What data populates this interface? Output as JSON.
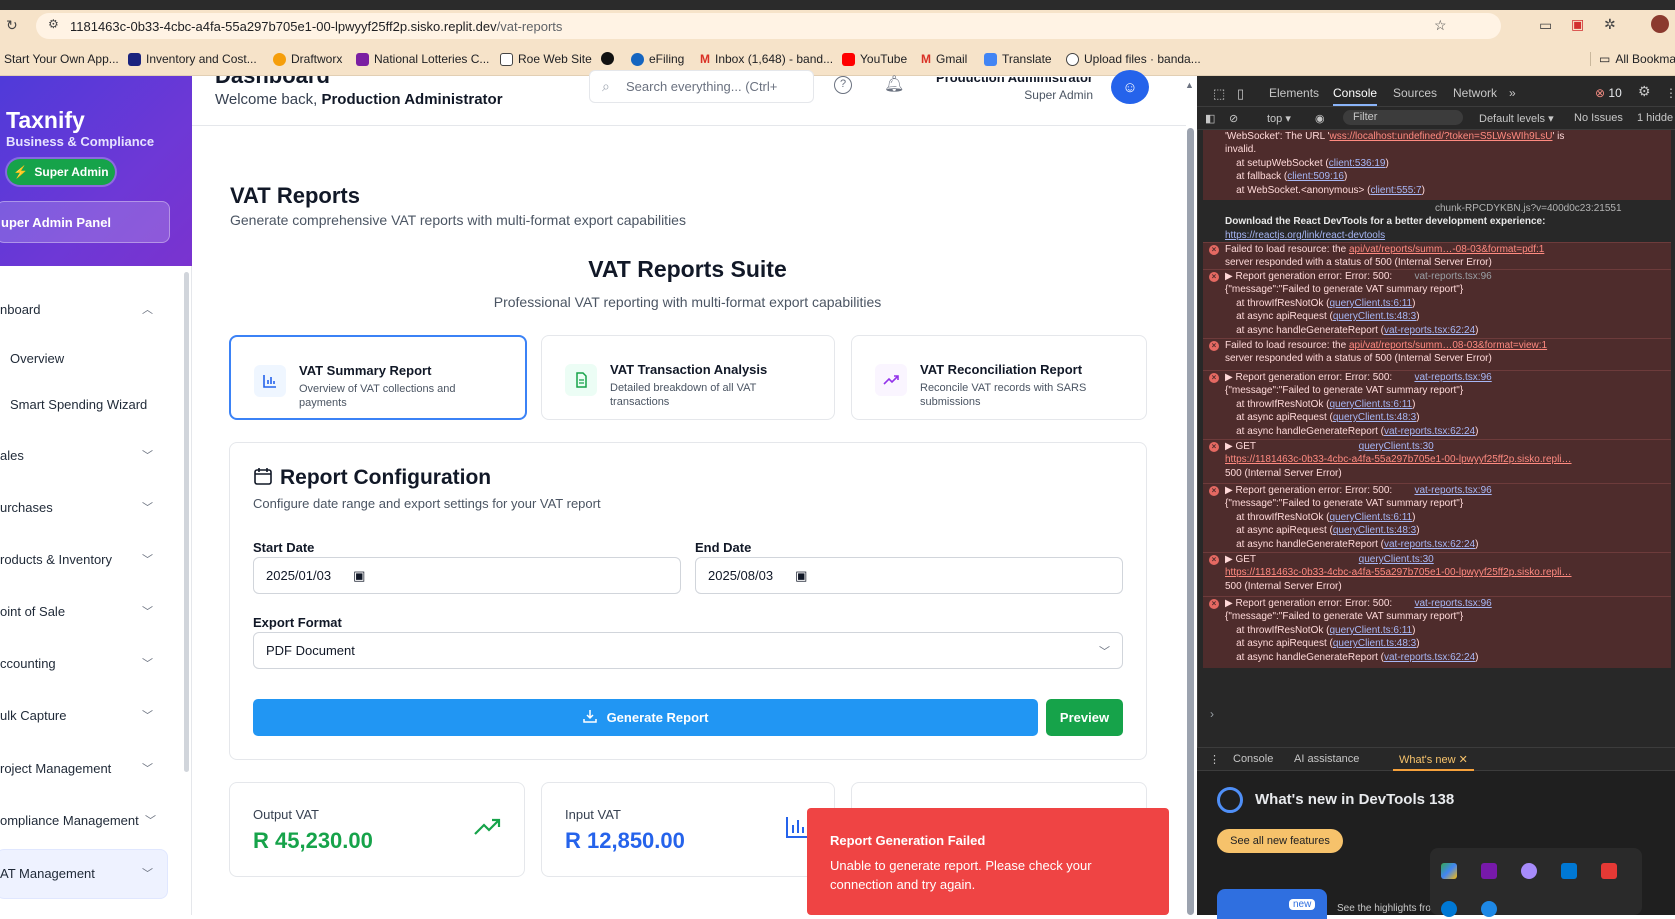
{
  "browser": {
    "url_host": "1181463c-0b33-4cbc-a4fa-55a297b705e1-00-lpwyyf25ff2p.sisko.replit.dev",
    "url_path": "/vat-reports",
    "bookmarks": [
      "Start Your Own App...",
      "Inventory and Cost...",
      "Draftworx",
      "National Lotteries C...",
      "Roe Web Site",
      "eFiling",
      "Inbox (1,648) - band...",
      "YouTube",
      "Gmail",
      "Translate",
      "Upload files · banda..."
    ],
    "all_bookmarks": "All Bookmarks"
  },
  "sidebar": {
    "brand": "Taxnify",
    "brand_sub": "Business & Compliance",
    "badge": "Super Admin",
    "panel_button": "uper Admin Panel",
    "items": [
      {
        "label": "nboard"
      },
      {
        "label": "Overview"
      },
      {
        "label": "Smart Spending Wizard"
      },
      {
        "label": "ales"
      },
      {
        "label": "urchases"
      },
      {
        "label": "roducts & Inventory"
      },
      {
        "label": "oint of Sale"
      },
      {
        "label": "ccounting"
      },
      {
        "label": "ulk Capture"
      },
      {
        "label": "roject Management"
      },
      {
        "label": "ompliance Management"
      },
      {
        "label": "AT Management"
      }
    ]
  },
  "header": {
    "title": "Dashboard",
    "welcome_prefix": "Welcome back,",
    "welcome_name": "Production Administrator",
    "search_placeholder": "Search everything... (Ctrl+",
    "user_name": "Production Administrator",
    "user_role": "Super Admin"
  },
  "main": {
    "title": "VAT Reports",
    "subtitle": "Generate comprehensive VAT reports with multi-format export capabilities",
    "suite_title": "VAT Reports Suite",
    "suite_subtitle": "Professional VAT reporting with multi-format export capabilities",
    "report_types": [
      {
        "title": "VAT Summary Report",
        "desc": "Overview of VAT collections and payments"
      },
      {
        "title": "VAT Transaction Analysis",
        "desc": "Detailed breakdown of all VAT transactions"
      },
      {
        "title": "VAT Reconciliation Report",
        "desc": "Reconcile VAT records with SARS submissions"
      }
    ],
    "config": {
      "title": "Report Configuration",
      "subtitle": "Configure date range and export settings for your VAT report",
      "start_label": "Start Date",
      "start_value": "2025/01/03",
      "end_label": "End Date",
      "end_value": "2025/08/03",
      "format_label": "Export Format",
      "format_value": "PDF Document",
      "generate": "Generate Report",
      "preview": "Preview"
    },
    "stats": [
      {
        "label": "Output VAT",
        "value": "R 45,230.00",
        "color": "#16a34a"
      },
      {
        "label": "Input VAT",
        "value": "R 12,850.00",
        "color": "#2563eb"
      }
    ],
    "toast": {
      "title": "Report Generation Failed",
      "message": "Unable to generate report. Please check your connection and try again."
    }
  },
  "devtools": {
    "tabs": [
      "Elements",
      "Console",
      "Sources",
      "Network"
    ],
    "error_count": "10",
    "toolbar": {
      "context": "top",
      "filter": "Filter",
      "levels": "Default levels",
      "issues": "No Issues",
      "hidden": "1 hidde"
    },
    "drawer_tabs": [
      "Console",
      "AI assistance",
      "What's new"
    ],
    "whats_new_title": "What's new in DevTools 138",
    "whats_new_button": "See all new features",
    "whats_new_highlights": "See the highlights fro",
    "whats_new_badge": "new"
  }
}
